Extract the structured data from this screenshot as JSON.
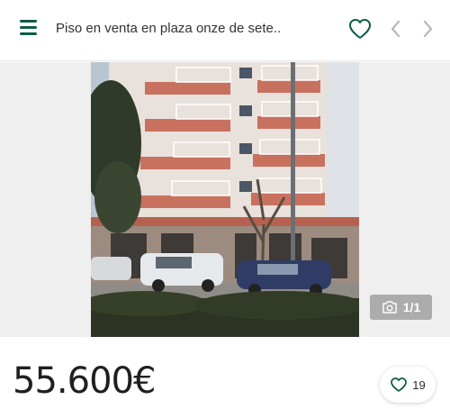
{
  "header": {
    "title": "Piso en venta en plaza onze de sete...",
    "menu_icon": "hamburger-icon",
    "favorite_icon": "heart-outline-icon",
    "prev_icon": "chevron-left-icon",
    "next_icon": "chevron-right-icon"
  },
  "gallery": {
    "photo_subject": "apartment building facade with balconies, parked cars and trees",
    "counter": "1/1",
    "counter_icon": "camera-icon"
  },
  "listing": {
    "price": "55.600€",
    "favorites_count": "19",
    "favorites_icon": "heart-outline-icon"
  },
  "colors": {
    "brand": "#0c5c47",
    "nav_gray": "#b8b8b8",
    "text": "#2b2b2b"
  }
}
